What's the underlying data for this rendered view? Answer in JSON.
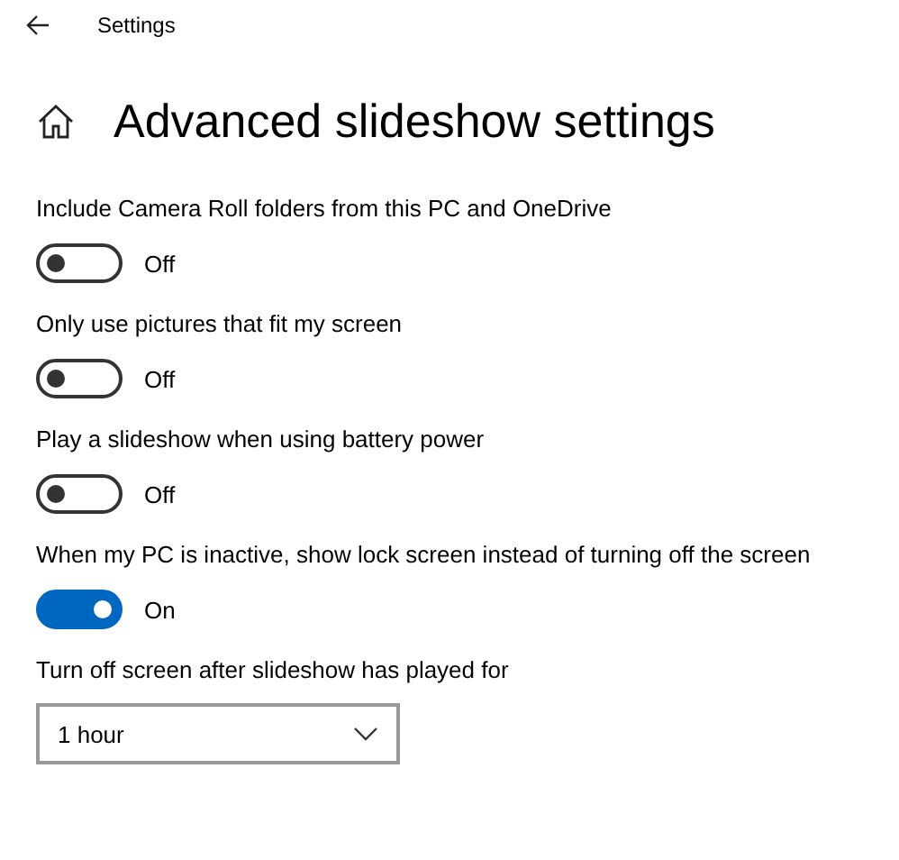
{
  "window": {
    "title": "Settings"
  },
  "page": {
    "title": "Advanced slideshow settings"
  },
  "settings": [
    {
      "kind": "toggle",
      "label": "Include Camera Roll folders from this PC and OneDrive",
      "on": false,
      "state_text": "Off"
    },
    {
      "kind": "toggle",
      "label": "Only use pictures that fit my screen",
      "on": false,
      "state_text": "Off"
    },
    {
      "kind": "toggle",
      "label": "Play a slideshow when using battery power",
      "on": false,
      "state_text": "Off"
    },
    {
      "kind": "toggle",
      "label": "When my PC is inactive, show lock screen instead of turning off the screen",
      "on": true,
      "state_text": "On"
    },
    {
      "kind": "dropdown",
      "label": "Turn off screen after slideshow has played for",
      "value": "1 hour"
    }
  ]
}
